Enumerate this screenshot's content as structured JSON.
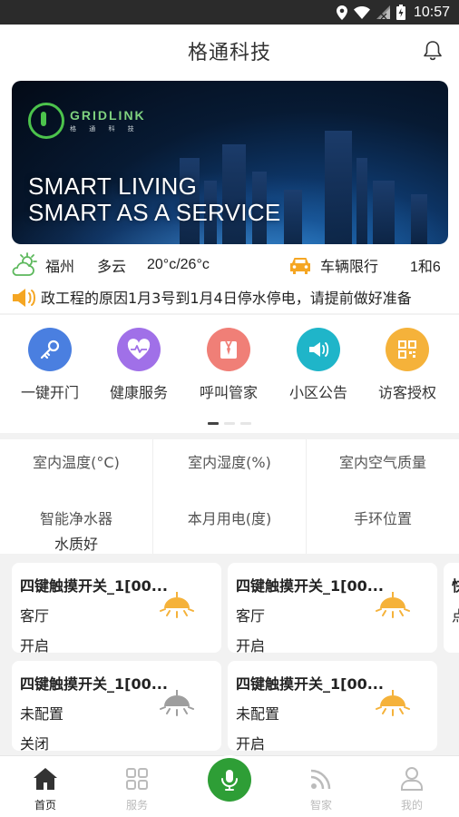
{
  "status_bar": {
    "time": "10:57"
  },
  "header": {
    "title": "格通科技"
  },
  "banner": {
    "logo_text": "GRIDLINK",
    "logo_sub": "格 通 科 技",
    "slogan_line1": "SMART LIVING",
    "slogan_line2": "SMART AS A SERVICE"
  },
  "weather": {
    "city": "福州",
    "condition": "多云",
    "temperature": "20°c/26°c",
    "traffic_label": "车辆限行",
    "traffic_numbers": "1和6"
  },
  "notice": {
    "text": "政工程的原因1月3号到1月4日停水停电，请提前做好准备"
  },
  "quick_actions": [
    {
      "label": "一键开门",
      "icon": "key-icon",
      "color": "#4a7fe0"
    },
    {
      "label": "健康服务",
      "icon": "heart-pulse-icon",
      "color": "#a070e8"
    },
    {
      "label": "呼叫管家",
      "icon": "butler-icon",
      "color": "#f07f77"
    },
    {
      "label": "小区公告",
      "icon": "megaphone-icon",
      "color": "#1fb5c9"
    },
    {
      "label": "访客授权",
      "icon": "qr-code-icon",
      "color": "#f5b23a"
    }
  ],
  "carousel": {
    "pages": 3,
    "active": 0
  },
  "stats": [
    {
      "label": "室内温度(°C)",
      "value": ""
    },
    {
      "label": "室内湿度(%)",
      "value": ""
    },
    {
      "label": "室内空气质量",
      "value": ""
    },
    {
      "label": "智能净水器",
      "value": "水质好"
    },
    {
      "label": "本月用电(度)",
      "value": ""
    },
    {
      "label": "手环位置",
      "value": ""
    }
  ],
  "devices": [
    {
      "name": "四键触摸开关_1[00...",
      "room": "客厅",
      "state": "开启",
      "lamp_on": true
    },
    {
      "name": "四键触摸开关_1[00...",
      "room": "客厅",
      "state": "开启",
      "lamp_on": true
    },
    {
      "name": "快",
      "room": "点",
      "state": "",
      "lamp_on": false
    },
    {
      "name": "四键触摸开关_1[00...",
      "room": "未配置",
      "state": "关闭",
      "lamp_on": false
    },
    {
      "name": "四键触摸开关_1[00...",
      "room": "未配置",
      "state": "开启",
      "lamp_on": true
    }
  ],
  "tabbar": {
    "home": "首页",
    "service": "服务",
    "smarthome": "智家",
    "mine": "我的"
  },
  "colors": {
    "accent_green": "#2e9e36",
    "lamp_on": "#f5b23a",
    "lamp_off": "#9e9e9e",
    "car_icon": "#f5a623",
    "weather_icon": "#5cb85c"
  }
}
